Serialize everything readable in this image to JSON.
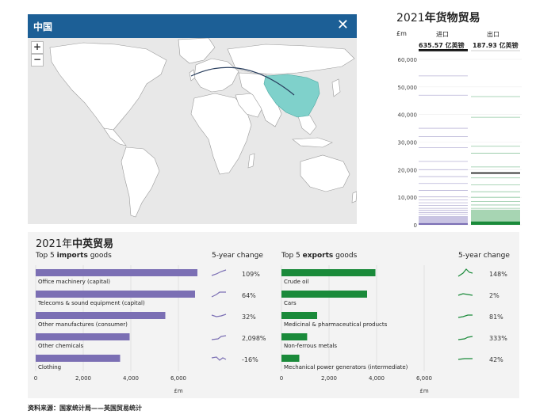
{
  "map": {
    "header_title": "中国",
    "close_icon": "close-icon",
    "zoom_in": "+",
    "zoom_out": "−",
    "colors": {
      "header": "#1c5f96",
      "highlight": "#7fd1cb",
      "land": "#ffffff",
      "ocean": "#e8e8e8"
    }
  },
  "trade_strip": {
    "title_year": "2021",
    "title_bold": "年货物贸易",
    "unit": "£m",
    "imports_label": "进口",
    "exports_label": "出口",
    "imports_value": "635.57 亿英镑",
    "exports_value": "187.93 亿英镑",
    "y_ticks": [
      "60,000",
      "50,000",
      "40,000",
      "30,000",
      "20,000",
      "10,000",
      "0"
    ],
    "imports_highlight": 63557,
    "exports_highlight": 18793,
    "colors": {
      "imports": "#7b6fb4",
      "exports": "#1a8a3a"
    }
  },
  "uk_china": {
    "title_year": "2021年",
    "title_bold": "中英贸易",
    "imports_heading_prefix": "Top 5 ",
    "imports_heading_bold": "imports",
    "imports_heading_suffix": " goods",
    "exports_heading_prefix": "Top 5 ",
    "exports_heading_bold": "exports",
    "exports_heading_suffix": " goods",
    "change_heading": "5-year change",
    "axis_unit": "£m",
    "x_ticks": [
      "0",
      "2,000",
      "4,000",
      "6,000"
    ]
  },
  "chart_data": [
    {
      "type": "bar",
      "title": "Top 5 imports goods",
      "categories": [
        "Office machinery (capital)",
        "Telecoms & sound equipment (capital)",
        "Other manufactures (consumer)",
        "Other chemicals",
        "Clothing"
      ],
      "values": [
        6800,
        6700,
        5450,
        3950,
        3550
      ],
      "five_year_change": [
        "109%",
        "64%",
        "32%",
        "2,098%",
        "-16%"
      ],
      "xlabel": "£m",
      "xlim": [
        0,
        7000
      ]
    },
    {
      "type": "bar",
      "title": "Top 5 exports goods",
      "categories": [
        "Crude oil",
        "Cars",
        "Medicinal & pharmaceutical products",
        "Non-ferrous metals",
        "Mechanical power generators (intermediate)"
      ],
      "values": [
        3950,
        3600,
        1500,
        1080,
        750
      ],
      "five_year_change": [
        "148%",
        "2%",
        "81%",
        "333%",
        "42%"
      ],
      "xlabel": "£m",
      "xlim": [
        0,
        7000
      ]
    }
  ],
  "footer": {
    "source": "资料来源：国家统计局——英国贸易统计"
  }
}
